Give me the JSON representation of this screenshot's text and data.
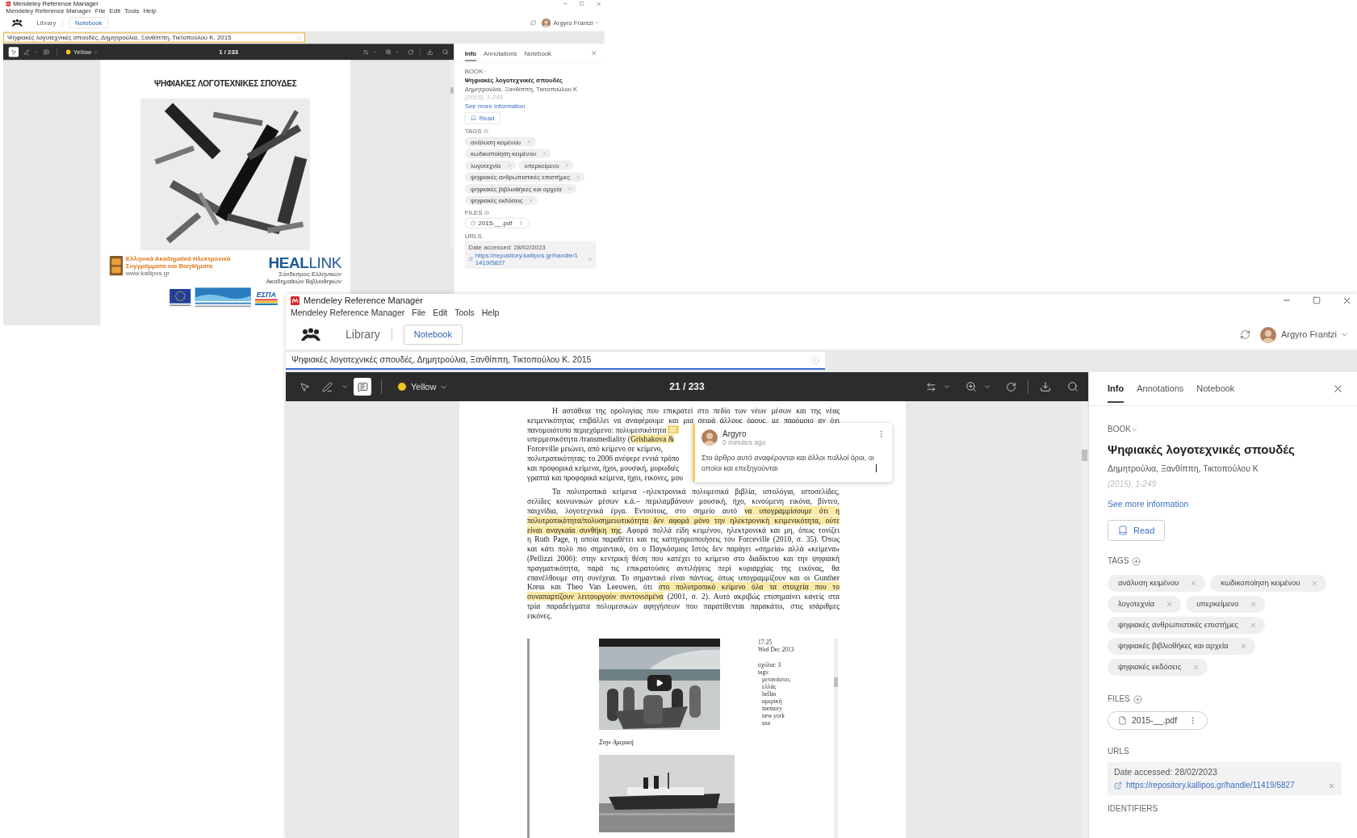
{
  "windows": [
    {
      "kind": "background",
      "title": "Mendeley Reference Manager",
      "menu": [
        "Mendeley Reference Manager",
        "File",
        "Edit",
        "Tools",
        "Help"
      ],
      "nav": {
        "items": [
          {
            "label": "Library",
            "selected": false
          },
          {
            "label": "Notebook",
            "selected": true
          }
        ]
      },
      "user": {
        "name": "Argyro Frantzi"
      },
      "search": {
        "value": "Ψηφιακές λογοτεχνικές σπουδές, Δημητρούλια, Ξανθίππη, Τικτοπούλου Κ. 2015"
      },
      "toolbar": {
        "tools": [
          {
            "kind": "select",
            "selected": true
          },
          {
            "kind": "pen",
            "selected": false
          },
          {
            "kind": "note",
            "selected": false
          }
        ],
        "color_label": "Yellow",
        "page": "1 / 233"
      },
      "document": {
        "kind": "cover",
        "title": "ΨΗΦΙΑΚΕΣ ΛΟΓΟΤΕΧΝΙΚΕΣ ΣΠΟΥΔΕΣ",
        "publisher": {
          "lines": [
            "Ελληνικά Ακαδημαϊκά Ηλεκτρονικά",
            "Συγγράμματα και Βοηθήματα"
          ],
          "url": "www.kallipos.gr"
        },
        "partner": {
          "name": "**HEAL**LINK",
          "subtitle": "Σύνδεσμος Ελληνικών Ακαδημαϊκών Βιβλιοθηκών"
        },
        "funding": {
          "label": "ΕΣΠΑ"
        }
      },
      "panel": {
        "tabs": [
          {
            "label": "Info",
            "selected": true
          },
          {
            "label": "Annotations",
            "selected": false
          },
          {
            "label": "Notebook",
            "selected": false
          }
        ],
        "type": "BOOK",
        "title": "Ψηφιακές λογοτεχνικές σπουδές",
        "authors": "Δημητρούλια, Ξανθίππη, Τικτοπούλου Κ",
        "year": "(2015), 1-249",
        "more_link": "See more information",
        "read_button": "Read",
        "tags_heading": "TAGS",
        "tags": [
          "ανάλυση κειμένου",
          "κωδικοποίηση κειμένου",
          "λογοτεχνία",
          "υπερκείμενο",
          "ψηφιακές ανθρωπιστικές επιστήμες",
          "ψηφιακές βιβλιοθήκες και αρχεία",
          "ψηφιακές εκδόσεις"
        ],
        "files_heading": "FILES",
        "files": [
          "2015-__.pdf"
        ],
        "urls_heading": "URLS",
        "url": {
          "date": "Date accessed: 28/02/2023",
          "link": "https://repository.kallipos.gr/handle/11419/5827"
        }
      }
    },
    {
      "kind": "foreground",
      "title": "Mendeley Reference Manager",
      "menu": [
        "Mendeley Reference Manager",
        "File",
        "Edit",
        "Tools",
        "Help"
      ],
      "nav": {
        "items": [
          {
            "label": "Library",
            "selected": false
          },
          {
            "label": "Notebook",
            "selected": true
          }
        ]
      },
      "user": {
        "name": "Argyro Frantzi"
      },
      "search": {
        "value": "Ψηφιακές λογοτεχνικές σπουδές, Δημητρούλια, Ξανθίππη, Τικτοπούλου Κ. 2015"
      },
      "toolbar": {
        "tools": [
          {
            "kind": "select",
            "selected": false
          },
          {
            "kind": "pen",
            "selected": false
          },
          {
            "kind": "note",
            "selected": true
          }
        ],
        "color_label": "Yellow",
        "page": "21 / 233"
      },
      "document": {
        "kind": "page",
        "paragraphs": [
          {
            "lines": [
              {
                "kind": "first",
                "segments": [
                  {
                    "text": "Η αστάθεια της ορολογίας που επικρατεί στο πεδίο των νέων μέσων και της νέας",
                    "highlighted": false
                  }
                ]
              },
              {
                "kind": "full",
                "segments": [
                  {
                    "text": "κειμενικότητας επιβάλλει να αναφέρουμε και μια σειρά άλλους όρους, με παρόμοιο αν όχι",
                    "highlighted": false
                  }
                ]
              },
              {
                "kind": "anchor",
                "segments": [
                  {
                    "text": "πανομοιότυπο περιεχόμενο: πολυμεσικότητα",
                    "highlighted": false
                  }
                ]
              },
              {
                "kind": "covered",
                "segments": [
                  {
                    "text": "υπερμεσικότητα /transmediality (",
                    "highlighted": false
                  },
                  {
                    "text": "Grishakova &",
                    "highlighted": true
                  }
                ]
              },
              {
                "kind": "covered",
                "segments": [
                  {
                    "text": "Forceville μειώνει, από κείμενο σε κείμενο,",
                    "highlighted": false
                  }
                ]
              },
              {
                "kind": "covered",
                "segments": [
                  {
                    "text": "πολυτροπικότητας: το 2006 ανέφερε εννιά τρόπο",
                    "highlighted": false
                  }
                ]
              },
              {
                "kind": "covered",
                "segments": [
                  {
                    "text": "και προφορικά κείμενα, ήχοι, μουσική, μυρωδιές",
                    "highlighted": false
                  }
                ]
              },
              {
                "kind": "covered",
                "segments": [
                  {
                    "text": "γραπτά και προφορικά κείμενα, ήχοι, εικόνες, μου",
                    "highlighted": false
                  }
                ]
              }
            ]
          },
          {
            "lines": [
              {
                "kind": "first",
                "segments": [
                  {
                    "text": "Τα πολυτροπικά κείμενα –ηλεκτρονικά πολυμεσικά βιβλία, ιστολόγια, ιστοσελίδες,",
                    "highlighted": false
                  }
                ]
              },
              {
                "kind": "full",
                "segments": [
                  {
                    "text": "σελίδες κοινωνικών μέσων κ.ά.– περιλαμβάνουν μουσική, ήχο, κινούμενη εικόνα, βίντεο,",
                    "highlighted": false
                  }
                ]
              },
              {
                "kind": "full",
                "segments": [
                  {
                    "text": "παιχνίδια, λογοτεχνικά έργα. Εντούτοις, στο σημείο αυτό ",
                    "highlighted": false
                  },
                  {
                    "text": "να υπογραμμίσουμε ότι η",
                    "highlighted": true
                  }
                ]
              },
              {
                "kind": "full",
                "segments": [
                  {
                    "text": "πολυτροπικότητα/πολυσημειωτικότητα δεν αφορά μόνο την ηλεκτρονική κειμενικότητα, ούτε",
                    "highlighted": true
                  }
                ]
              },
              {
                "kind": "full",
                "segments": [
                  {
                    "text": "είναι αναγκαία συνθήκη της",
                    "highlighted": true
                  },
                  {
                    "text": ". Αφορά πολλά είδη κειμένου, ηλεκτρονικά και μη, όπως τονίζει",
                    "highlighted": false
                  }
                ]
              },
              {
                "kind": "full",
                "segments": [
                  {
                    "text": "η Ruth Page, η οποία παραθέτει και τις κατηγοριοποιήσεις του Forceville (2010, σ. 35). Όπως",
                    "highlighted": false
                  }
                ]
              },
              {
                "kind": "full",
                "segments": [
                  {
                    "text": "και κάτι πολύ πιο σημαντικό, ότι ο Παγκόσμιος Ιστός δεν παράγει «σημεία» αλλά «κείμενα»",
                    "highlighted": false
                  }
                ]
              },
              {
                "kind": "full",
                "segments": [
                  {
                    "text": "(Pellizzi 2006): στην κεντρική θέση που κατέχει το κείμενο στο διαδίκτυο και την ψηφιακή",
                    "highlighted": false
                  }
                ]
              },
              {
                "kind": "full",
                "segments": [
                  {
                    "text": "πραγματικότητα, παρά τις επικρατούσες αντιλήψεις περί κυριαρχίας της εικόνας, θα",
                    "highlighted": false
                  }
                ]
              },
              {
                "kind": "full",
                "segments": [
                  {
                    "text": "επανέλθουμε στη συνέχεια. Το σημαντικό είναι πάντως, όπως υπογραμμίζουν και οι Gunther",
                    "highlighted": false
                  }
                ]
              },
              {
                "kind": "full",
                "segments": [
                  {
                    "text": "Kress και Theo Van Leeuwen, ότι ",
                    "highlighted": false
                  },
                  {
                    "text": "στο πολυτροπικό κείμενο όλα τα στοιχεία που το",
                    "highlighted": true
                  }
                ]
              },
              {
                "kind": "full",
                "segments": [
                  {
                    "text": "συναπαρτίζουν λειτουργούν συντονισμένα",
                    "highlighted": true
                  },
                  {
                    "text": " (2001, σ. 2). Αυτό ακριβώς επισημαίνει κανείς στα",
                    "highlighted": false
                  }
                ]
              },
              {
                "kind": "full",
                "segments": [
                  {
                    "text": "τρία παραδείγματα πολυμεσικών αφηγήσεων που παρατίθενται παρακάτω, στις ισάριθμες",
                    "highlighted": false
                  }
                ]
              },
              {
                "kind": "last",
                "segments": [
                  {
                    "text": "εικόνες.",
                    "highlighted": false
                  }
                ]
              }
            ]
          }
        ],
        "annotation": {
          "author": "Argyro",
          "time": "0 minutes ago",
          "text": "Στο άρθρο αυτό αναφέρονται και άλλοι πολλοί όροι, οι οποίοι και επεξηγούνται"
        },
        "embed": {
          "time": "17:25",
          "date": "Wed Dec 2013",
          "comments": "σχόλια: 3",
          "tags_label": "tags:",
          "tags": [
            "μετανάστες",
            "ελλάς",
            "hellas",
            "αμερική",
            "memory",
            "new york",
            "usa"
          ],
          "caption": "Στην Αμερική"
        }
      },
      "panel": {
        "tabs": [
          {
            "label": "Info",
            "selected": true
          },
          {
            "label": "Annotations",
            "selected": false
          },
          {
            "label": "Notebook",
            "selected": false
          }
        ],
        "type": "BOOK",
        "title": "Ψηφιακές λογοτεχνικές σπουδές",
        "authors": "Δημητρούλια, Ξανθίππη, Τικτοπούλου Κ",
        "year": "(2015), 1-249",
        "more_link": "See more information",
        "read_button": "Read",
        "tags_heading": "TAGS",
        "tags": [
          "ανάλυση κειμένου",
          "κωδικοποίηση κειμένου",
          "λογοτεχνία",
          "υπερκείμενο",
          "ψηφιακές ανθρωπιστικές επιστήμες",
          "ψηφιακές βιβλιοθήκες και αρχεία",
          "ψηφιακές εκδόσεις"
        ],
        "files_heading": "FILES",
        "files": [
          "2015-__.pdf"
        ],
        "urls_heading": "URLS",
        "url": {
          "date": "Date accessed: 28/02/2023",
          "link": "https://repository.kallipos.gr/handle/11419/5827"
        },
        "identifiers_heading": "IDENTIFIERS"
      }
    }
  ]
}
